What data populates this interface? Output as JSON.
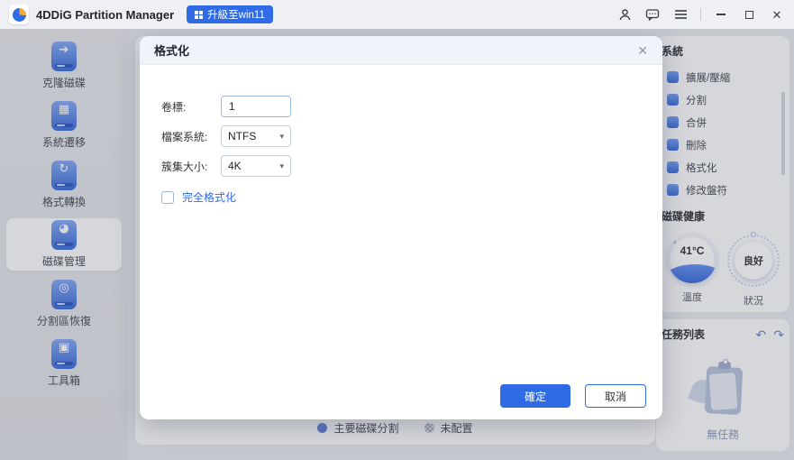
{
  "titlebar": {
    "app_title": "4DDiG Partition Manager",
    "upgrade_label": "升級至win11",
    "window_controls": {
      "close": "✕"
    }
  },
  "sidebar": {
    "items": [
      {
        "label": "克隆磁碟",
        "icon": "clone-disk-icon",
        "glyph": "➔"
      },
      {
        "label": "系統遷移",
        "icon": "system-migration-icon",
        "glyph": "▦"
      },
      {
        "label": "格式轉換",
        "icon": "format-convert-icon",
        "glyph": "↻"
      },
      {
        "label": "磁碟管理",
        "icon": "disk-management-icon",
        "glyph": "◕"
      },
      {
        "label": "分割區恢復",
        "icon": "partition-recovery-icon",
        "glyph": "◎"
      },
      {
        "label": "工具箱",
        "icon": "toolbox-icon",
        "glyph": "▣"
      }
    ]
  },
  "dialog": {
    "title": "格式化",
    "fields": [
      {
        "label": "卷標:",
        "value": "1"
      },
      {
        "label": "檔案系統:",
        "value": "NTFS"
      },
      {
        "label": "簇集大小:",
        "value": "4K"
      }
    ],
    "caret": "▾",
    "checkbox_label": "完全格式化",
    "ok_label": "確定",
    "cancel_label": "取消"
  },
  "right_panel": {
    "section_title": "系統",
    "items": [
      {
        "label": "擴展/壓縮",
        "icon": "expand-shrink-icon"
      },
      {
        "label": "分割",
        "icon": "split-partition-icon"
      },
      {
        "label": "合併",
        "icon": "merge-partition-icon"
      },
      {
        "label": "刪除",
        "icon": "delete-partition-icon"
      },
      {
        "label": "格式化",
        "icon": "format-partition-icon"
      },
      {
        "label": "修改盤符",
        "icon": "change-drive-letter-icon"
      }
    ],
    "health_title": "磁碟健康",
    "temperature_value": "41°C",
    "temperature_label": "溫度",
    "status_value": "良好",
    "status_label": "狀況"
  },
  "tasks": {
    "title": "任務列表",
    "undo_icon": "↶",
    "redo_icon": "↷",
    "empty_label": "無任務"
  },
  "legend": {
    "primary": "主要磁碟分割",
    "unallocated": "未配置"
  },
  "colors": {
    "accent": "#2e6be5"
  }
}
